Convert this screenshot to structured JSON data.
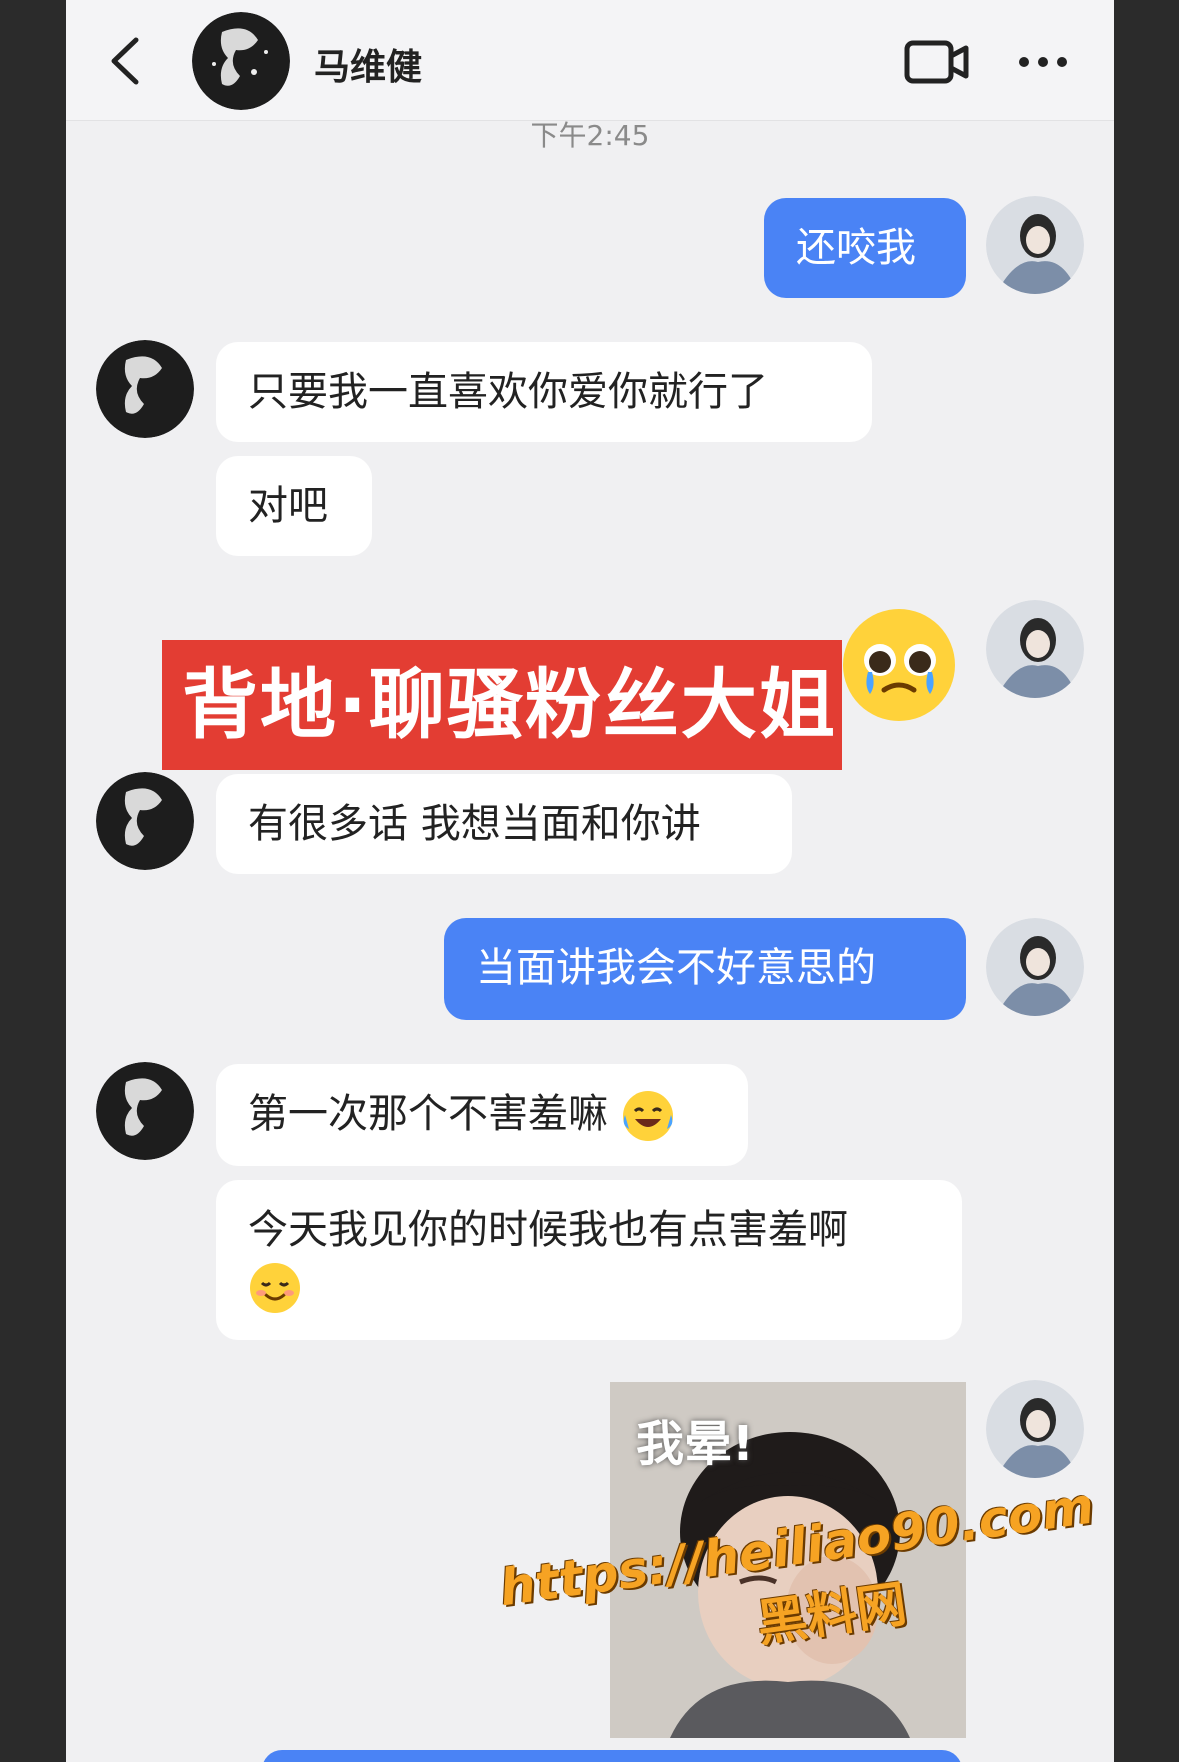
{
  "header": {
    "contact_name": "马维健",
    "back_icon": "chevron-left-icon",
    "video_icon": "video-call-icon",
    "more_icon": "more-icon"
  },
  "timestamp": "下午2:45",
  "messages": [
    {
      "side": "out",
      "text": "还咬我"
    },
    {
      "side": "in",
      "text": "只要我一直喜欢你爱你就行了"
    },
    {
      "side": "in",
      "text": "对吧"
    },
    {
      "side": "out",
      "emoji": "pleading-crying-face"
    },
    {
      "side": "in",
      "text": "有很多话 我想当面和你讲"
    },
    {
      "side": "out",
      "text": "当面讲我会不好意思的"
    },
    {
      "side": "in",
      "text": "第一次那个不害羞嘛",
      "emoji": "laughing-crying-face"
    },
    {
      "side": "in",
      "text": "今天我见你的时候我也有点害羞啊",
      "emoji": "smiling-blushing-face"
    },
    {
      "side": "out",
      "sticker_caption": "我晕!"
    }
  ],
  "overlay_banner": "背地·聊骚粉丝大姐",
  "watermark": {
    "url": "https://heiliao90.com",
    "name": "黑料网"
  },
  "colors": {
    "accent": "#4a83f5",
    "banner": "#e33d33",
    "watermark": "#f6a323"
  }
}
